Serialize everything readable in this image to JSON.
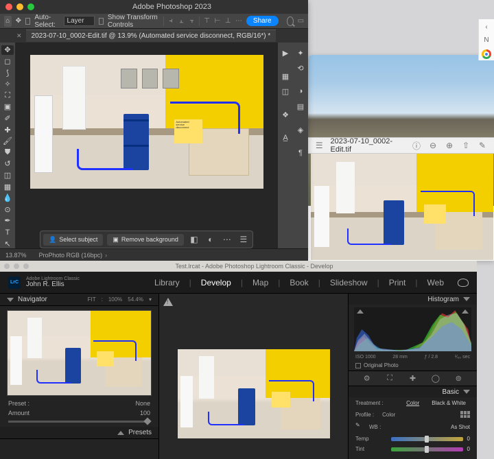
{
  "photoshop": {
    "app_title": "Adobe Photoshop 2023",
    "options": {
      "auto_select_label": "Auto-Select:",
      "auto_select_mode": "Layer",
      "show_transform_label": "Show Transform Controls",
      "share_label": "Share"
    },
    "doc_tab": "2023-07-10_0002-Edit.tif @ 13.9% (Automated service disconnect, RGB/16*) *",
    "context": {
      "select_subject": "Select subject",
      "remove_bg": "Remove background"
    },
    "canvas_note_lines": [
      "Automated",
      "service",
      "disconnect"
    ],
    "status": {
      "zoom": "13.87%",
      "profile": "ProPhoto RGB (16bpc)"
    }
  },
  "preview": {
    "filename": "2023-07-10_0002-Edit.tif"
  },
  "finder": {
    "new_label": "N"
  },
  "lightroom": {
    "mac_title": "Test.lrcat - Adobe Photoshop Lightroom Classic - Develop",
    "product": "Adobe Lightroom Classic",
    "user": "John R. Ellis",
    "modules": [
      "Library",
      "Develop",
      "Map",
      "Book",
      "Slideshow",
      "Print",
      "Web"
    ],
    "active_module": "Develop",
    "navigator": {
      "title": "Navigator",
      "fit": "FIT",
      "pct1": "100%",
      "pct2": "54.4%"
    },
    "preset_row": {
      "label": "Preset :",
      "value": "None"
    },
    "amount_row": {
      "label": "Amount",
      "value": "100"
    },
    "presets_title": "Presets",
    "histogram": {
      "title": "Histogram",
      "iso": "ISO 1000",
      "focal": "28 mm",
      "ap": "ƒ / 2.8",
      "shutter": "¹⁄₆₀ sec"
    },
    "original_label": "Original Photo",
    "basic": {
      "title": "Basic",
      "treatment": "Treatment :",
      "color": "Color",
      "bw": "Black & White",
      "profile_label": "Profile :",
      "profile": "Color",
      "wb_label": "WB :",
      "wb_value": "As Shot",
      "temp_label": "Temp",
      "temp_value": "0",
      "tint_label": "Tint",
      "tint_value": "0"
    }
  }
}
